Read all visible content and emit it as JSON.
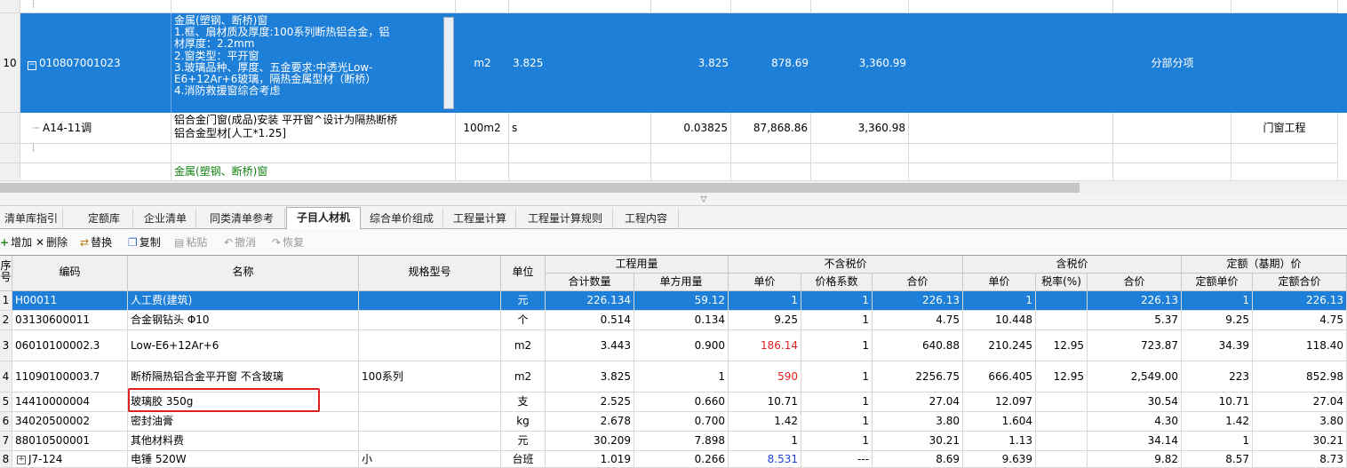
{
  "upper": {
    "top_row_dots": "┆",
    "item_row": {
      "num": "10",
      "code": "010807001023",
      "name_lines": [
        "金属(塑钢、断桥)窗",
        "1.框、扇材质及厚度:100系列断热铝合金，铝",
        "材厚度：2.2mm",
        "2.窗类型：平开窗",
        "3.玻璃品种、厚度、五金要求:中透光Low-",
        "E6+12Ar+6玻璃，隔热金属型材（断桥）",
        "4.消防救援窗综合考虑"
      ],
      "ellipsis": "...",
      "unit": "m2",
      "qty_expr": "3.825",
      "qty": "3.825",
      "unit_price": "878.69",
      "total": "3,360.99",
      "category": "分部分项"
    },
    "sub_row": {
      "code": "A14-11调",
      "name_lines": [
        "铝合金门窗(成品)安装 平开窗^设计为隔热断桥",
        "铝合金型材[人工*1.25]"
      ],
      "unit": "100m2",
      "qty_expr": "s",
      "qty": "0.03825",
      "unit_price": "87,868.86",
      "total": "3,360.98",
      "category": "门窗工程"
    },
    "next_item_name": "金属(塑钢、断桥)窗"
  },
  "tabs": [
    "清单库指引",
    "定额库",
    "企业清单",
    "同类清单参考",
    "子目人材机",
    "综合单价组成",
    "工程量计算",
    "工程量计算规则",
    "工程内容"
  ],
  "active_tab": "子目人材机",
  "toolbar": {
    "add": "增加",
    "delete": "删除",
    "replace": "替换",
    "copy": "复制",
    "paste": "粘贴",
    "undo": "撤消",
    "redo": "恢复"
  },
  "grid": {
    "headers": {
      "seq": "序号",
      "code": "编码",
      "name": "名称",
      "spec": "规格型号",
      "unit": "单位",
      "group_qty": "工程用量",
      "total_qty": "合计数量",
      "unit_qty": "单方用量",
      "group_notax": "不含税价",
      "price": "单价",
      "factor": "价格系数",
      "sum": "合价",
      "group_tax": "含税价",
      "tax_price": "单价",
      "tax_rate": "税率(%)",
      "tax_sum": "合价",
      "group_quota": "定额（基期）价",
      "quota_price": "定额单价",
      "quota_sum": "定额合价"
    },
    "rows": [
      {
        "seq": "1",
        "code": "H00011",
        "name": "人工费(建筑)",
        "spec": "",
        "unit": "元",
        "total_qty": "226.134",
        "unit_qty": "59.12",
        "price": "1",
        "factor": "1",
        "sum": "226.13",
        "tax_price": "1",
        "tax_rate": "",
        "tax_sum": "226.13",
        "quota_price": "1",
        "quota_sum": "226.13"
      },
      {
        "seq": "2",
        "code": "03130600011",
        "name": "合金钢钻头 Φ10",
        "spec": "",
        "unit": "个",
        "total_qty": "0.514",
        "unit_qty": "0.134",
        "price": "9.25",
        "factor": "1",
        "sum": "4.75",
        "tax_price": "10.448",
        "tax_rate": "",
        "tax_sum": "5.37",
        "quota_price": "9.25",
        "quota_sum": "4.75"
      },
      {
        "seq": "3",
        "code": "06010100002.3",
        "name": "Low-E6+12Ar+6",
        "spec": "",
        "unit": "m2",
        "total_qty": "3.443",
        "unit_qty": "0.900",
        "price": "186.14",
        "factor": "1",
        "sum": "640.88",
        "tax_price": "210.245",
        "tax_rate": "12.95",
        "tax_sum": "723.87",
        "quota_price": "34.39",
        "quota_sum": "118.40"
      },
      {
        "seq": "4",
        "code": "11090100003.7",
        "name": "断桥隔热铝合金平开窗 不含玻璃",
        "spec": "100系列",
        "unit": "m2",
        "total_qty": "3.825",
        "unit_qty": "1",
        "price": "590",
        "factor": "1",
        "sum": "2256.75",
        "tax_price": "666.405",
        "tax_rate": "12.95",
        "tax_sum": "2,549.00",
        "quota_price": "223",
        "quota_sum": "852.98"
      },
      {
        "seq": "5",
        "code": "14410000004",
        "name": "玻璃胶 350g",
        "spec": "",
        "unit": "支",
        "total_qty": "2.525",
        "unit_qty": "0.660",
        "price": "10.71",
        "factor": "1",
        "sum": "27.04",
        "tax_price": "12.097",
        "tax_rate": "",
        "tax_sum": "30.54",
        "quota_price": "10.71",
        "quota_sum": "27.04"
      },
      {
        "seq": "6",
        "code": "34020500002",
        "name": "密封油膏",
        "spec": "",
        "unit": "kg",
        "total_qty": "2.678",
        "unit_qty": "0.700",
        "price": "1.42",
        "factor": "1",
        "sum": "3.80",
        "tax_price": "1.604",
        "tax_rate": "",
        "tax_sum": "4.30",
        "quota_price": "1.42",
        "quota_sum": "3.80"
      },
      {
        "seq": "7",
        "code": "88010500001",
        "name": "其他材料费",
        "spec": "",
        "unit": "元",
        "total_qty": "30.209",
        "unit_qty": "7.898",
        "price": "1",
        "factor": "1",
        "sum": "30.21",
        "tax_price": "1.13",
        "tax_rate": "",
        "tax_sum": "34.14",
        "quota_price": "1",
        "quota_sum": "30.21"
      },
      {
        "seq": "8",
        "code": "J7-124",
        "name": "电锤 520W",
        "spec": "小",
        "unit": "台班",
        "total_qty": "1.019",
        "unit_qty": "0.266",
        "price": "8.531",
        "factor": "---",
        "sum": "8.69",
        "tax_price": "9.639",
        "tax_rate": "",
        "tax_sum": "9.82",
        "quota_price": "8.57",
        "quota_sum": "8.73"
      }
    ]
  },
  "colors": {
    "selection": "#1e7fd8",
    "price_changed_up": "#e02020",
    "price_changed_down": "#2040d0",
    "highlight_box": "#e02020"
  }
}
